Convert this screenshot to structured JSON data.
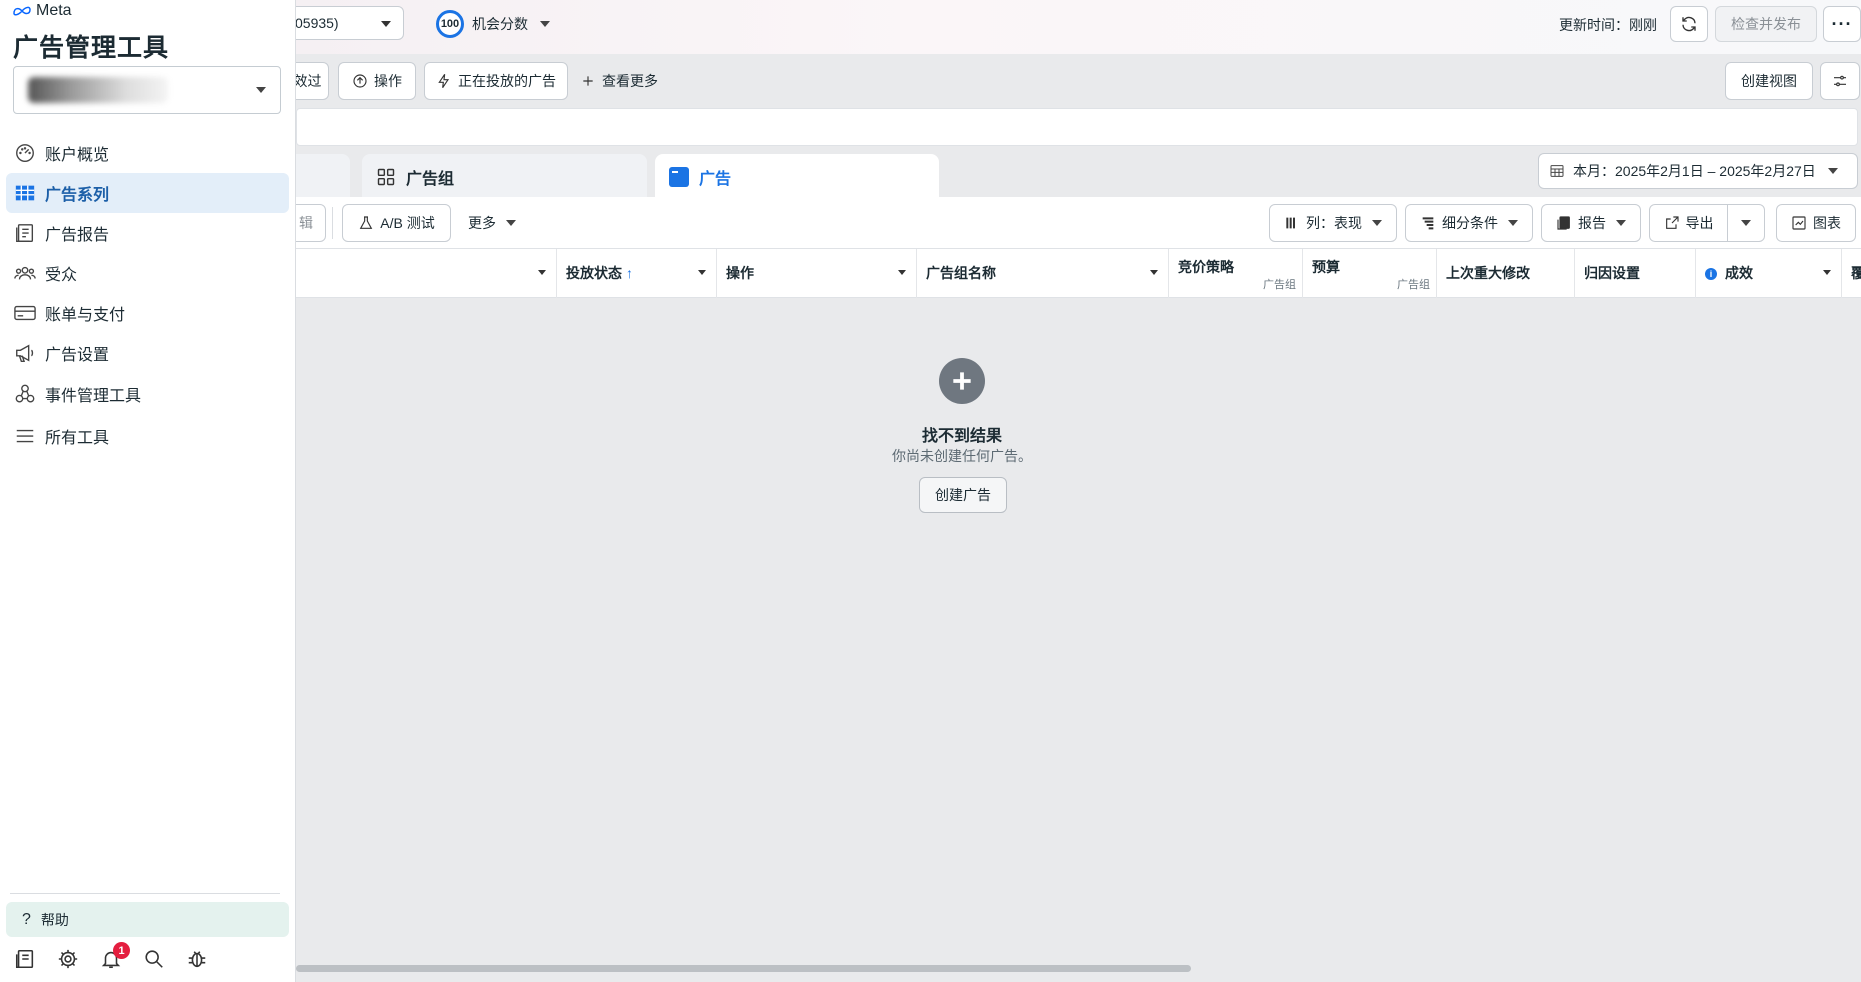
{
  "sidebar": {
    "brand": "Meta",
    "title": "广告管理工具",
    "nav": [
      {
        "label": "账户概览",
        "icon": "gauge-icon"
      },
      {
        "label": "广告系列",
        "icon": "table-grid-icon",
        "active": true
      },
      {
        "label": "广告报告",
        "icon": "report-icon"
      },
      {
        "label": "受众",
        "icon": "people-icon"
      },
      {
        "label": "账单与支付",
        "icon": "credit-card-icon"
      },
      {
        "label": "广告设置",
        "icon": "megaphone-icon"
      },
      {
        "label": "事件管理工具",
        "icon": "events-icon"
      },
      {
        "label": "所有工具",
        "icon": "menu-icon"
      }
    ],
    "help": "帮助",
    "notification_count": "1"
  },
  "topbar": {
    "account_id": "05935)",
    "opportunity_score_value": "100",
    "opportunity_score_label": "机会分数",
    "update_time": "更新时间：刚刚",
    "review_publish": "检查并发布",
    "more": "···"
  },
  "toolbar": {
    "filter_partial": "效过",
    "actions": "操作",
    "active_ads": "正在投放的广告",
    "see_more": "查看更多",
    "create_view": "创建视图"
  },
  "tabs": [
    {
      "label": "广告组",
      "icon": "ad-set-grid-icon"
    },
    {
      "label": "广告",
      "icon": "ad-icon",
      "active": true
    }
  ],
  "date_range": "本月：2025年2月1日 – 2025年2月27日",
  "actionbar": {
    "edit_partial": "辑",
    "ab_test": "A/B 测试",
    "more": "更多",
    "columns": "列：表现",
    "breakdown": "细分条件",
    "reports": "报告",
    "export": "导出",
    "charts": "图表"
  },
  "table": {
    "columns": [
      {
        "label": ""
      },
      {
        "label": "投放状态",
        "sort": "↑"
      },
      {
        "label": "操作"
      },
      {
        "label": "广告组名称"
      },
      {
        "label": "竞价策略",
        "sub": "广告组"
      },
      {
        "label": "预算",
        "sub": "广告组"
      },
      {
        "label": "上次重大修改"
      },
      {
        "label": "归因设置"
      },
      {
        "label": "成效"
      },
      {
        "label": "覆"
      }
    ]
  },
  "empty_state": {
    "title": "找不到结果",
    "subtitle": "你尚未创建任何广告。",
    "button": "创建广告"
  },
  "colors": {
    "accent": "#1b74e4",
    "active_nav_bg": "#e3eef9",
    "help_bg": "#e4f2ee",
    "badge": "#e41e3f"
  }
}
